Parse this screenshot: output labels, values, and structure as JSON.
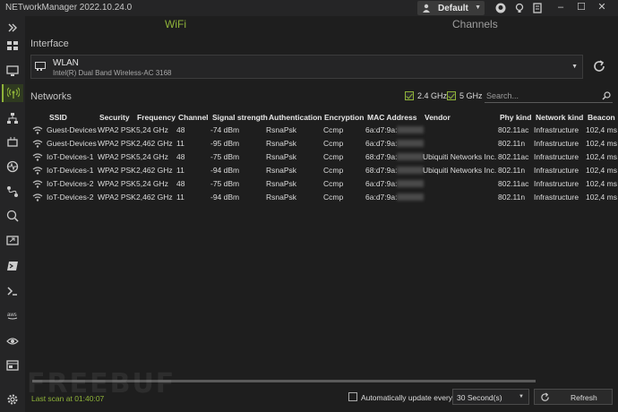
{
  "app": {
    "title": "NETworkManager 2022.10.24.0",
    "profile": "Default"
  },
  "tabs": [
    {
      "label": "WiFi",
      "active": true
    },
    {
      "label": "Channels",
      "active": false
    }
  ],
  "interface": {
    "section_label": "Interface",
    "name": "WLAN",
    "description": "Intel(R) Dual Band Wireless-AC 3168"
  },
  "networks": {
    "section_label": "Networks",
    "filters": {
      "band_24": "2.4 GHz",
      "band_5": "5 GHz"
    },
    "search_placeholder": "Search...",
    "columns": [
      "SSID",
      "Security",
      "Frequency",
      "Channel",
      "Signal strength",
      "Authentication",
      "Encryption",
      "MAC Address",
      "Vendor",
      "Phy kind",
      "Network kind",
      "Beacon"
    ],
    "rows": [
      {
        "ssid": "Guest-Devices",
        "security": "WPA2 PSK",
        "frequency": "5,24 GHz",
        "channel": "48",
        "signal": "-74 dBm",
        "auth": "RsnaPsk",
        "enc": "Ccmp",
        "mac": "6a:d7:9a:",
        "vendor": "",
        "phy": "802.11ac",
        "netkind": "Infrastructure",
        "beacon": "102,4 ms"
      },
      {
        "ssid": "Guest-Devices",
        "security": "WPA2 PSK",
        "frequency": "2,462 GHz",
        "channel": "11",
        "signal": "-95 dBm",
        "auth": "RsnaPsk",
        "enc": "Ccmp",
        "mac": "6a:d7:9a:",
        "vendor": "",
        "phy": "802.11n",
        "netkind": "Infrastructure",
        "beacon": "102,4 ms"
      },
      {
        "ssid": "IoT-Devices-1",
        "security": "WPA2 PSK",
        "frequency": "5,24 GHz",
        "channel": "48",
        "signal": "-75 dBm",
        "auth": "RsnaPsk",
        "enc": "Ccmp",
        "mac": "68:d7:9a:",
        "vendor": "Ubiquiti Networks Inc.",
        "phy": "802.11ac",
        "netkind": "Infrastructure",
        "beacon": "102,4 ms"
      },
      {
        "ssid": "IoT-Devices-1",
        "security": "WPA2 PSK",
        "frequency": "2,462 GHz",
        "channel": "11",
        "signal": "-94 dBm",
        "auth": "RsnaPsk",
        "enc": "Ccmp",
        "mac": "68:d7:9a:",
        "vendor": "Ubiquiti Networks Inc.",
        "phy": "802.11n",
        "netkind": "Infrastructure",
        "beacon": "102,4 ms"
      },
      {
        "ssid": "IoT-Devices-2",
        "security": "WPA2 PSK",
        "frequency": "5,24 GHz",
        "channel": "48",
        "signal": "-75 dBm",
        "auth": "RsnaPsk",
        "enc": "Ccmp",
        "mac": "6a:d7:9a:",
        "vendor": "",
        "phy": "802.11ac",
        "netkind": "Infrastructure",
        "beacon": "102,4 ms"
      },
      {
        "ssid": "IoT-Devices-2",
        "security": "WPA2 PSK",
        "frequency": "2,462 GHz",
        "channel": "11",
        "signal": "-94 dBm",
        "auth": "RsnaPsk",
        "enc": "Ccmp",
        "mac": "6a:d7:9a:",
        "vendor": "",
        "phy": "802.11n",
        "netkind": "Infrastructure",
        "beacon": "102,4 ms"
      }
    ]
  },
  "footer": {
    "last_scan": "Last scan at 01:40:07",
    "auto_update_label": "Automatically update every",
    "interval": "30 Second(s)",
    "refresh_label": "Refresh"
  },
  "watermark": "FREEBUF",
  "colors": {
    "accent": "#8fb339",
    "background": "#1e1e1e",
    "panel": "#252526"
  }
}
